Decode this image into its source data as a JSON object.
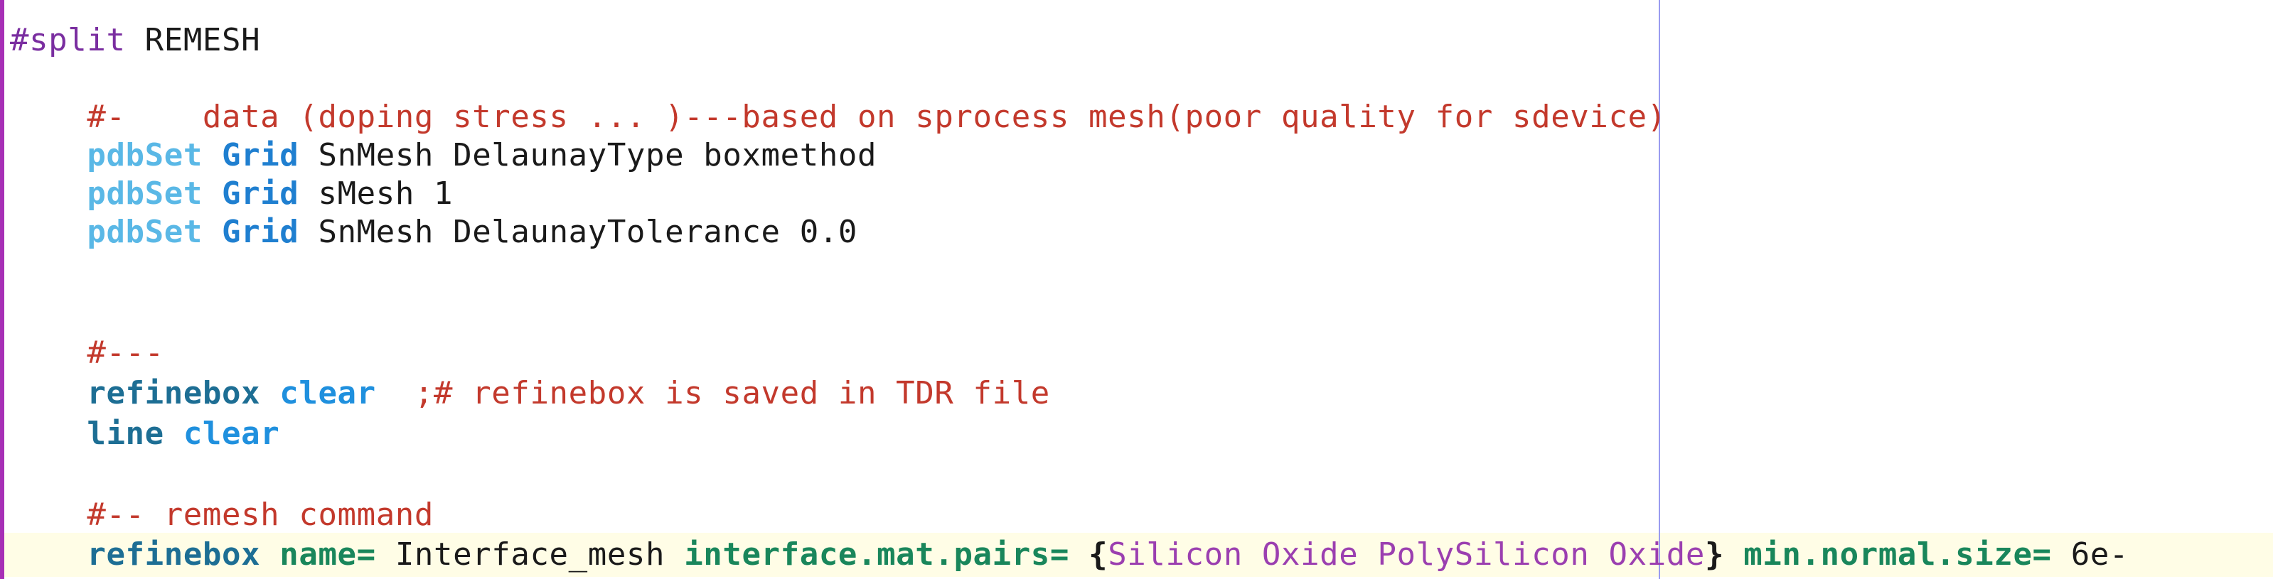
{
  "editor": {
    "lines": [
      {
        "segments": [
          {
            "text": "#split",
            "cls": "t-split"
          },
          {
            "text": " REMESH",
            "cls": "t-default"
          }
        ]
      },
      {
        "segments": []
      },
      {
        "segments": [
          {
            "text": "    #-    data (doping stress ... )---based on sprocess mesh(poor quality for sdevice)",
            "cls": "t-comment"
          }
        ]
      },
      {
        "segments": [
          {
            "text": "    ",
            "cls": "t-default"
          },
          {
            "text": "pdbSet",
            "cls": "t-pdb"
          },
          {
            "text": " ",
            "cls": "t-default"
          },
          {
            "text": "Grid",
            "cls": "t-grid"
          },
          {
            "text": " SnMesh DelaunayType boxmethod",
            "cls": "t-default"
          }
        ]
      },
      {
        "segments": [
          {
            "text": "    ",
            "cls": "t-default"
          },
          {
            "text": "pdbSet",
            "cls": "t-pdb"
          },
          {
            "text": " ",
            "cls": "t-default"
          },
          {
            "text": "Grid",
            "cls": "t-grid"
          },
          {
            "text": " sMesh 1",
            "cls": "t-default"
          }
        ]
      },
      {
        "segments": [
          {
            "text": "    ",
            "cls": "t-default"
          },
          {
            "text": "pdbSet",
            "cls": "t-pdb"
          },
          {
            "text": " ",
            "cls": "t-default"
          },
          {
            "text": "Grid",
            "cls": "t-grid"
          },
          {
            "text": " SnMesh DelaunayTolerance 0.0",
            "cls": "t-default"
          }
        ]
      },
      {
        "segments": []
      },
      {
        "segments": []
      },
      {
        "segments": [
          {
            "text": "    #---",
            "cls": "t-comment"
          }
        ]
      },
      {
        "segments": [
          {
            "text": "    ",
            "cls": "t-default"
          },
          {
            "text": "refinebox",
            "cls": "t-cmd"
          },
          {
            "text": " ",
            "cls": "t-default"
          },
          {
            "text": "clear",
            "cls": "t-kw2"
          },
          {
            "text": "  ;# refinebox is saved in TDR file",
            "cls": "t-comment"
          }
        ]
      },
      {
        "segments": [
          {
            "text": "    ",
            "cls": "t-default"
          },
          {
            "text": "line",
            "cls": "t-cmd"
          },
          {
            "text": " ",
            "cls": "t-default"
          },
          {
            "text": "clear",
            "cls": "t-kw2"
          }
        ]
      },
      {
        "segments": []
      },
      {
        "segments": [
          {
            "text": "    #-- remesh command",
            "cls": "t-comment"
          }
        ]
      },
      {
        "segments": [
          {
            "text": "    ",
            "cls": "t-default"
          },
          {
            "text": "refinebox",
            "cls": "t-cmd"
          },
          {
            "text": " ",
            "cls": "t-default"
          },
          {
            "text": "name=",
            "cls": "t-param"
          },
          {
            "text": " Interface_mesh ",
            "cls": "t-default"
          },
          {
            "text": "interface.mat.pairs=",
            "cls": "t-param"
          },
          {
            "text": " ",
            "cls": "t-default"
          },
          {
            "text": "{",
            "cls": "t-brace"
          },
          {
            "text": "Silicon Oxide PolySilicon Oxide",
            "cls": "t-str"
          },
          {
            "text": "}",
            "cls": "t-brace"
          },
          {
            "text": " ",
            "cls": "t-default"
          },
          {
            "text": "min.normal.size=",
            "cls": "t-param"
          },
          {
            "text": " 6e-",
            "cls": "t-default"
          }
        ]
      }
    ]
  }
}
